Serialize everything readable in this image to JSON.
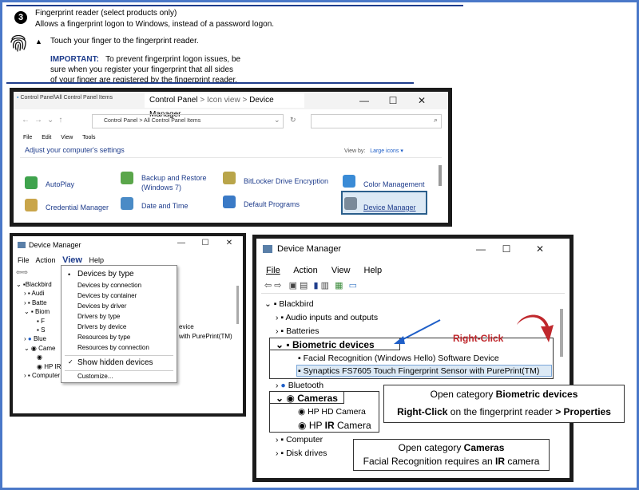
{
  "step": {
    "number": "3",
    "title": "Fingerprint reader (select products only)",
    "description": "Allows a fingerprint logon to Windows, instead of a password logon.",
    "bullet": "Touch your finger to the fingerprint reader.",
    "important_label": "IMPORTANT:",
    "important_text": "To prevent fingerprint logon issues, be sure when you register your fingerprint that all sides of your finger are registered by the fingerprint reader."
  },
  "control_panel": {
    "tab_inactive": "Control Panel\\All Control Panel Items",
    "tab_active_prefix": "Control Panel",
    "tab_active_sep1": " > ",
    "tab_active_mid": "Icon view",
    "tab_active_sep2": " > ",
    "tab_active_suffix": "Device Manager",
    "address": "Control Panel  >  All Control Panel Items",
    "menu": [
      "File",
      "Edit",
      "View",
      "Tools"
    ],
    "heading": "Adjust your computer's settings",
    "view_by_label": "View by:",
    "view_by_value": "Large icons ▾",
    "items": {
      "autoplay": "AutoPlay",
      "backup_line1": "Backup and Restore",
      "backup_line2": "(Windows 7)",
      "bitlocker": "BitLocker Drive Encryption",
      "color": "Color Management",
      "credential": "Credential Manager",
      "datetime": "Date and Time",
      "default_programs": "Default Programs",
      "device_manager": "Device Manager"
    }
  },
  "dm_small": {
    "title": "Device Manager",
    "menu": {
      "file": "File",
      "action": "Action",
      "view": "View",
      "help": "Help"
    },
    "tree": [
      "Blackbird",
      "Audi",
      "Batte",
      "Biom",
      "F",
      "S",
      "Blue",
      "Came",
      "Computer"
    ],
    "tree_hp_ir": "HP IR Camera",
    "behind1": "evice",
    "behind2": "with PurePrint(TM)",
    "dropdown": {
      "devices_by_type": "Devices by type",
      "devices_by_connection": "Devices by connection",
      "devices_by_container": "Devices by container",
      "devices_by_driver": "Devices by driver",
      "drivers_by_type": "Drivers by type",
      "drivers_by_device": "Drivers by device",
      "resources_by_type": "Resources by type",
      "resources_by_connection": "Resources by connection",
      "show_hidden": "Show hidden devices",
      "customize": "Customize..."
    }
  },
  "dm_large": {
    "title": "Device Manager",
    "menu": {
      "file": "File",
      "action": "Action",
      "view": "View",
      "help": "Help"
    },
    "tree": {
      "root": "Blackbird",
      "audio": "Audio inputs and outputs",
      "batteries": "Batteries",
      "biometric": "Biometric devices",
      "facial": "Facial Recognition (Windows Hello) Software Device",
      "synaptics": "Synaptics FS7605 Touch Fingerprint Sensor with PurePrint(TM)",
      "bluetooth": "Bluetooth",
      "cameras": "Cameras",
      "hp_hd": "HP HD Camera",
      "hp_ir_prefix": "HP ",
      "hp_ir_bold": "IR",
      "hp_ir_suffix": " Camera",
      "computer": "Computer",
      "disk": "Disk drives"
    },
    "right_click": "Right-Click"
  },
  "callouts": {
    "bio_line1_prefix": "Open category ",
    "bio_line1_bold": "Biometric devices",
    "bio_line2_bold1": "Right-Click",
    "bio_line2_mid": " on the fingerprint reader ",
    "bio_line2_bold2": "> Properties",
    "cam_line1_prefix": "Open category ",
    "cam_line1_bold": "Cameras",
    "cam_line2_prefix": "Facial Recognition requires an ",
    "cam_line2_bold": "IR",
    "cam_line2_suffix": " camera"
  },
  "colors": {
    "frame": "#4a78c8",
    "rule": "#1f3d8c",
    "link": "#1f3d8c",
    "red_arrow": "#c0282d",
    "blue_arrow": "#1f5fc8"
  }
}
